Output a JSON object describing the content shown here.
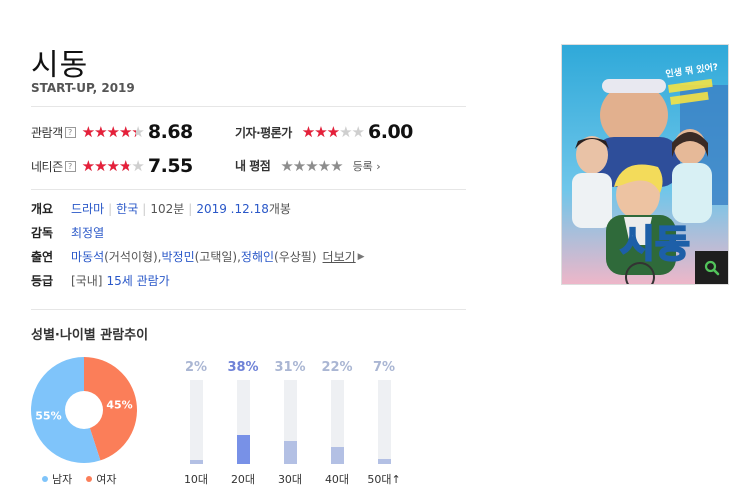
{
  "movie": {
    "title": "시동",
    "subtitle": "START-UP, 2019"
  },
  "ratings": {
    "audience": {
      "label": "관람객",
      "help": "?",
      "score": "8.68",
      "value": 8.68
    },
    "critic": {
      "label": "기자·평론가",
      "score": "6.00",
      "value": 6.0
    },
    "netizen": {
      "label": "네티즌",
      "help": "?",
      "score": "7.55",
      "value": 7.55
    },
    "mine": {
      "label": "내 평점",
      "register": "등록"
    }
  },
  "info": {
    "overview_label": "개요",
    "genre": "드라마",
    "country": "한국",
    "runtime": "102분",
    "release_date": "2019 .12.18",
    "release_suffix": " 개봉",
    "director_label": "감독",
    "director": "최정열",
    "cast_label": "출연",
    "cast": [
      {
        "name": "마동석",
        "role": "(거석이형)"
      },
      {
        "name": "박정민",
        "role": "(고택일)"
      },
      {
        "name": "정해인",
        "role": "(우상필)"
      }
    ],
    "more": "더보기",
    "grade_label": "등급",
    "grade_prefix": "[국내]",
    "grade": "15세 관람가"
  },
  "poster": {
    "tagline": "인생 뭐 있어?",
    "title_text": "시동",
    "zoom_icon": "search-icon"
  },
  "chart_section_title": "성별·나이별 관람추이",
  "chart_data": [
    {
      "type": "pie",
      "categories": [
        "남자",
        "여자"
      ],
      "values": [
        55,
        45
      ],
      "labels": [
        "55%",
        "45%"
      ],
      "colors": [
        "#7fc4fa",
        "#fb7e59"
      ],
      "legend": "bottom"
    },
    {
      "type": "bar",
      "categories": [
        "10대",
        "20대",
        "30대",
        "40대",
        "50대↑"
      ],
      "values": [
        2,
        38,
        31,
        22,
        7
      ],
      "labels": [
        "2%",
        "38%",
        "31%",
        "22%",
        "7%"
      ],
      "highlight": "20대",
      "ylim": [
        0,
        100
      ],
      "colors": {
        "normal": "#b3c0e4",
        "highlight": "#7891e7",
        "track": "#eef0f3"
      }
    }
  ]
}
